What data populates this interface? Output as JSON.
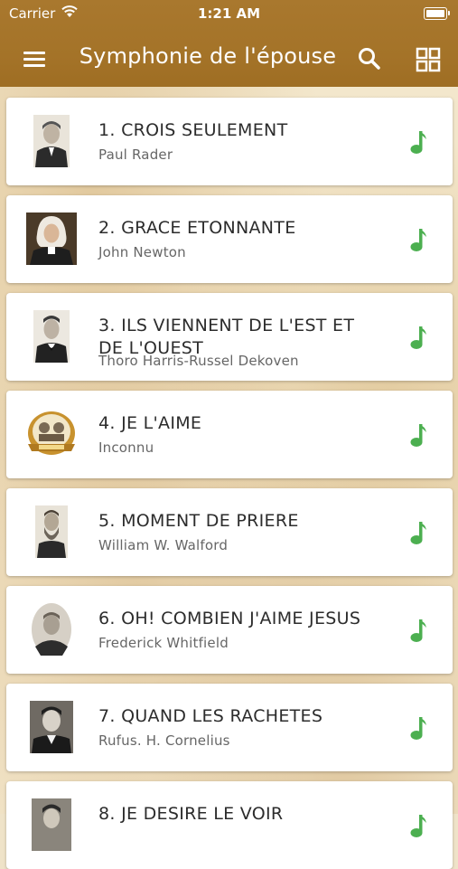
{
  "status_bar": {
    "carrier": "Carrier",
    "time": "1:21 AM"
  },
  "header": {
    "title": "Symphonie de l'épouse",
    "menu_icon": "hamburger-menu-icon",
    "search_icon": "search-icon",
    "grid_icon": "grid-view-icon"
  },
  "colors": {
    "header_bg": "#a47328",
    "note_green": "#4caf50",
    "title_text": "#2c2c2c",
    "author_text": "#666666"
  },
  "songs": [
    {
      "title": "1. CROIS SEULEMENT",
      "author": "Paul Rader",
      "icon": "music-note-icon"
    },
    {
      "title": "2. GRACE ETONNANTE",
      "author": "John Newton",
      "icon": "music-note-icon"
    },
    {
      "title": "3. ILS VIENNENT DE L'EST ET DE L'OUEST",
      "author": "Thoro Harris-Russel Dekoven",
      "icon": "music-note-icon"
    },
    {
      "title": "4. JE L'AIME",
      "author": "Inconnu",
      "icon": "music-note-icon"
    },
    {
      "title": "5. MOMENT DE PRIERE",
      "author": "William W. Walford",
      "icon": "music-note-icon"
    },
    {
      "title": "6. OH! COMBIEN J'AIME JESUS",
      "author": "Frederick Whitfield",
      "icon": "music-note-icon"
    },
    {
      "title": "7. QUAND LES RACHETES",
      "author": "Rufus. H. Cornelius",
      "icon": "music-note-icon"
    },
    {
      "title": "8. JE DESIRE LE VOIR",
      "author": "",
      "icon": "music-note-icon"
    }
  ]
}
